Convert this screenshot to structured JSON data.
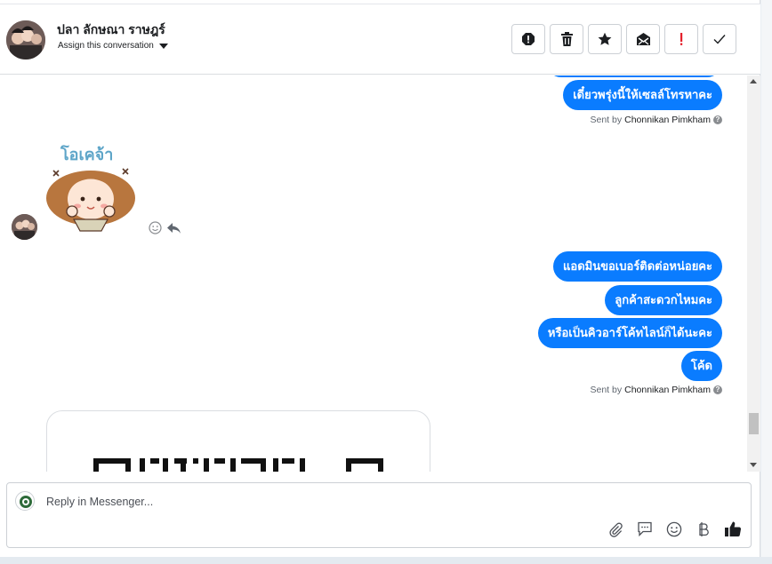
{
  "header": {
    "contact_name": "ปลา ลักษณา ราษฎร์",
    "assign_label": "Assign this conversation",
    "tools": [
      {
        "name": "spam-icon"
      },
      {
        "name": "trash-icon"
      },
      {
        "name": "star-icon"
      },
      {
        "name": "mark-unread-icon"
      },
      {
        "name": "follow-up-icon"
      },
      {
        "name": "done-icon"
      }
    ]
  },
  "messages": {
    "group1": {
      "bubbles": [
        "เดี๋ยวพรุ่งนี้ให้เซลล์โทรหาคะ"
      ],
      "sent_by_prefix": "Sent by",
      "sent_by_name": "Chonnikan Pimkham"
    },
    "incoming": {
      "sticker_text": "โอเคจ้า"
    },
    "group2": {
      "bubbles": [
        "แอดมินขอเบอร์ติดต่อหน่อยคะ",
        "ลูกค้าสะดวกไหมคะ",
        "หรือเป็นคิวอาร์โค้ทไลน์ก็ได้นะคะ",
        "โค้ด"
      ],
      "sent_by_prefix": "Sent by",
      "sent_by_name": "Chonnikan Pimkham"
    }
  },
  "composer": {
    "placeholder": "Reply in Messenger...",
    "icons": [
      "attach-icon",
      "saved-replies-icon",
      "emoji-icon",
      "payment-icon",
      "like-icon"
    ]
  },
  "colors": {
    "bubble": "#0a7cff",
    "border": "#dadde1"
  }
}
